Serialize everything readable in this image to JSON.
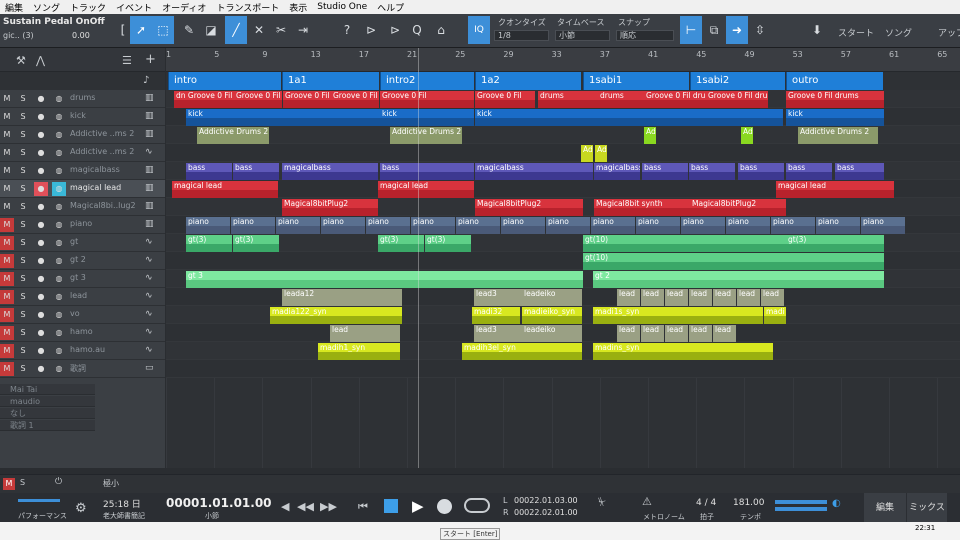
{
  "menu": [
    "編集",
    "ソング",
    "トラック",
    "イベント",
    "オーディオ",
    "トランスポート",
    "表示",
    "Studio One",
    "ヘルプ"
  ],
  "toolbar": {
    "device_title": "Sustain Pedal OnOff",
    "device_sub": "gic.. (3)",
    "device_value": "0.00",
    "iq": "IQ",
    "quantize_label": "クオンタイズ",
    "quantize_value": "1/8",
    "timebase_label": "タイムベース",
    "timebase_value": "小節",
    "snap_label": "スナップ",
    "snap_value": "順応",
    "start_label": "スタート",
    "song_label": "ソング",
    "upload_label": "アップ"
  },
  "ruler": [
    "1",
    "5",
    "9",
    "13",
    "17",
    "21",
    "25",
    "29",
    "33",
    "37",
    "41",
    "45",
    "49",
    "53",
    "57",
    "61",
    "65"
  ],
  "markers": [
    {
      "name": "intro"
    },
    {
      "name": "1a1"
    },
    {
      "name": "intro2"
    },
    {
      "name": "1a2"
    },
    {
      "name": "1sabi1"
    },
    {
      "name": "1sabi2"
    },
    {
      "name": "outro"
    }
  ],
  "tracks": [
    {
      "name": "drums",
      "icon": "piano-icon"
    },
    {
      "name": "kick",
      "icon": "piano-icon"
    },
    {
      "name": "Addictive ..ms 2",
      "icon": "piano-icon"
    },
    {
      "name": "Addictive ..ms 2",
      "icon": "wave-icon"
    },
    {
      "name": "magicalbass",
      "icon": "piano-icon"
    },
    {
      "name": "magical lead",
      "icon": "piano-icon"
    },
    {
      "name": "Magical8bi..lug2",
      "icon": "piano-icon"
    },
    {
      "name": "piano",
      "icon": "piano-icon"
    },
    {
      "name": "gt",
      "icon": "wave-icon"
    },
    {
      "name": "gt 2",
      "icon": "wave-icon"
    },
    {
      "name": "gt 3",
      "icon": "wave-icon"
    },
    {
      "name": "lead",
      "icon": "wave-icon"
    },
    {
      "name": "vo",
      "icon": "wave-icon"
    },
    {
      "name": "hamo",
      "icon": "wave-icon"
    },
    {
      "name": "hamo.au",
      "icon": "wave-icon"
    },
    {
      "name": "歌詞",
      "icon": "folder-icon"
    }
  ],
  "extra_rows": [
    "Mai Tai",
    "maudio",
    "なし",
    "歌詞 1"
  ],
  "clips": {
    "drums": [
      "dn Groove 0 Fil",
      "Groove 0 Fil",
      "Groove 0 Fil",
      "Groove 0 Fil",
      "Groove 0 Fil",
      "Groove 0 Fil",
      "drums",
      "drums",
      "Groove 0 Fil drums"
    ],
    "kick": [
      "kick",
      "kick",
      "kick",
      "kick"
    ],
    "addictive": [
      "Addictive Drums 2",
      "Addictive Drums 2",
      "Ad",
      "Ad",
      "Addictive Drums 2"
    ],
    "bass": [
      "bass",
      "bass",
      "magicalbass",
      "bass",
      "magicalbass",
      "magicalbass",
      "bass",
      "bass",
      "bass",
      "bass",
      "bass"
    ],
    "lead": [
      "magical lead",
      "magical lead",
      "magical lead"
    ],
    "plug": [
      "Magical8bitPlug2",
      "Magical8bitPlug2",
      "Magical8bit synth",
      "Magical8bitPlug2"
    ],
    "piano": [
      "piano",
      "piano",
      "piano",
      "piano",
      "piano",
      "piano",
      "piano",
      "piano",
      "piano",
      "piano",
      "piano",
      "piano",
      "piano",
      "piano",
      "piano",
      "piano"
    ],
    "gt": [
      "gt(3)",
      "gt(3)",
      "gt(3)",
      "gt(3)",
      "gt(10)",
      "gt(3)"
    ],
    "gt2": [
      "gt(10)"
    ],
    "gt3": [
      "gt 3",
      "gt 2"
    ],
    "leadA": [
      "leada12",
      "lead3",
      "leadeiko",
      "lead",
      "lead",
      "lead",
      "lead",
      "lead",
      "lead",
      "lead"
    ],
    "vo": [
      "madia122_syn",
      "madi32",
      "madieiko_syn",
      "madi1s_syn",
      "madi"
    ],
    "hamo": [
      "lead",
      "lead3",
      "leadeiko",
      "lead",
      "lead",
      "lead",
      "lead",
      "lead"
    ],
    "hamoau": [
      "madih1_syn",
      "madih3el_syn",
      "madins_syn"
    ]
  },
  "transport": {
    "time_top": "25:18 日",
    "time_sub": "老大師書簡記",
    "position": "00001.01.01.00",
    "position_unit": "小節",
    "loop_L": "00022.01.03.00",
    "loop_R": "00022.02.01.00",
    "metronome_label": "メトロノーム",
    "signature": "4 / 4",
    "signature_label": "拍子",
    "tempo": "181.00",
    "tempo_label": "テンポ",
    "edit_label": "編集",
    "mix_label": "ミックス",
    "perf_label": "パフォーマンス",
    "tooltip": "スタート [Enter]",
    "zoom_label": "極小",
    "clock": "22:31"
  }
}
